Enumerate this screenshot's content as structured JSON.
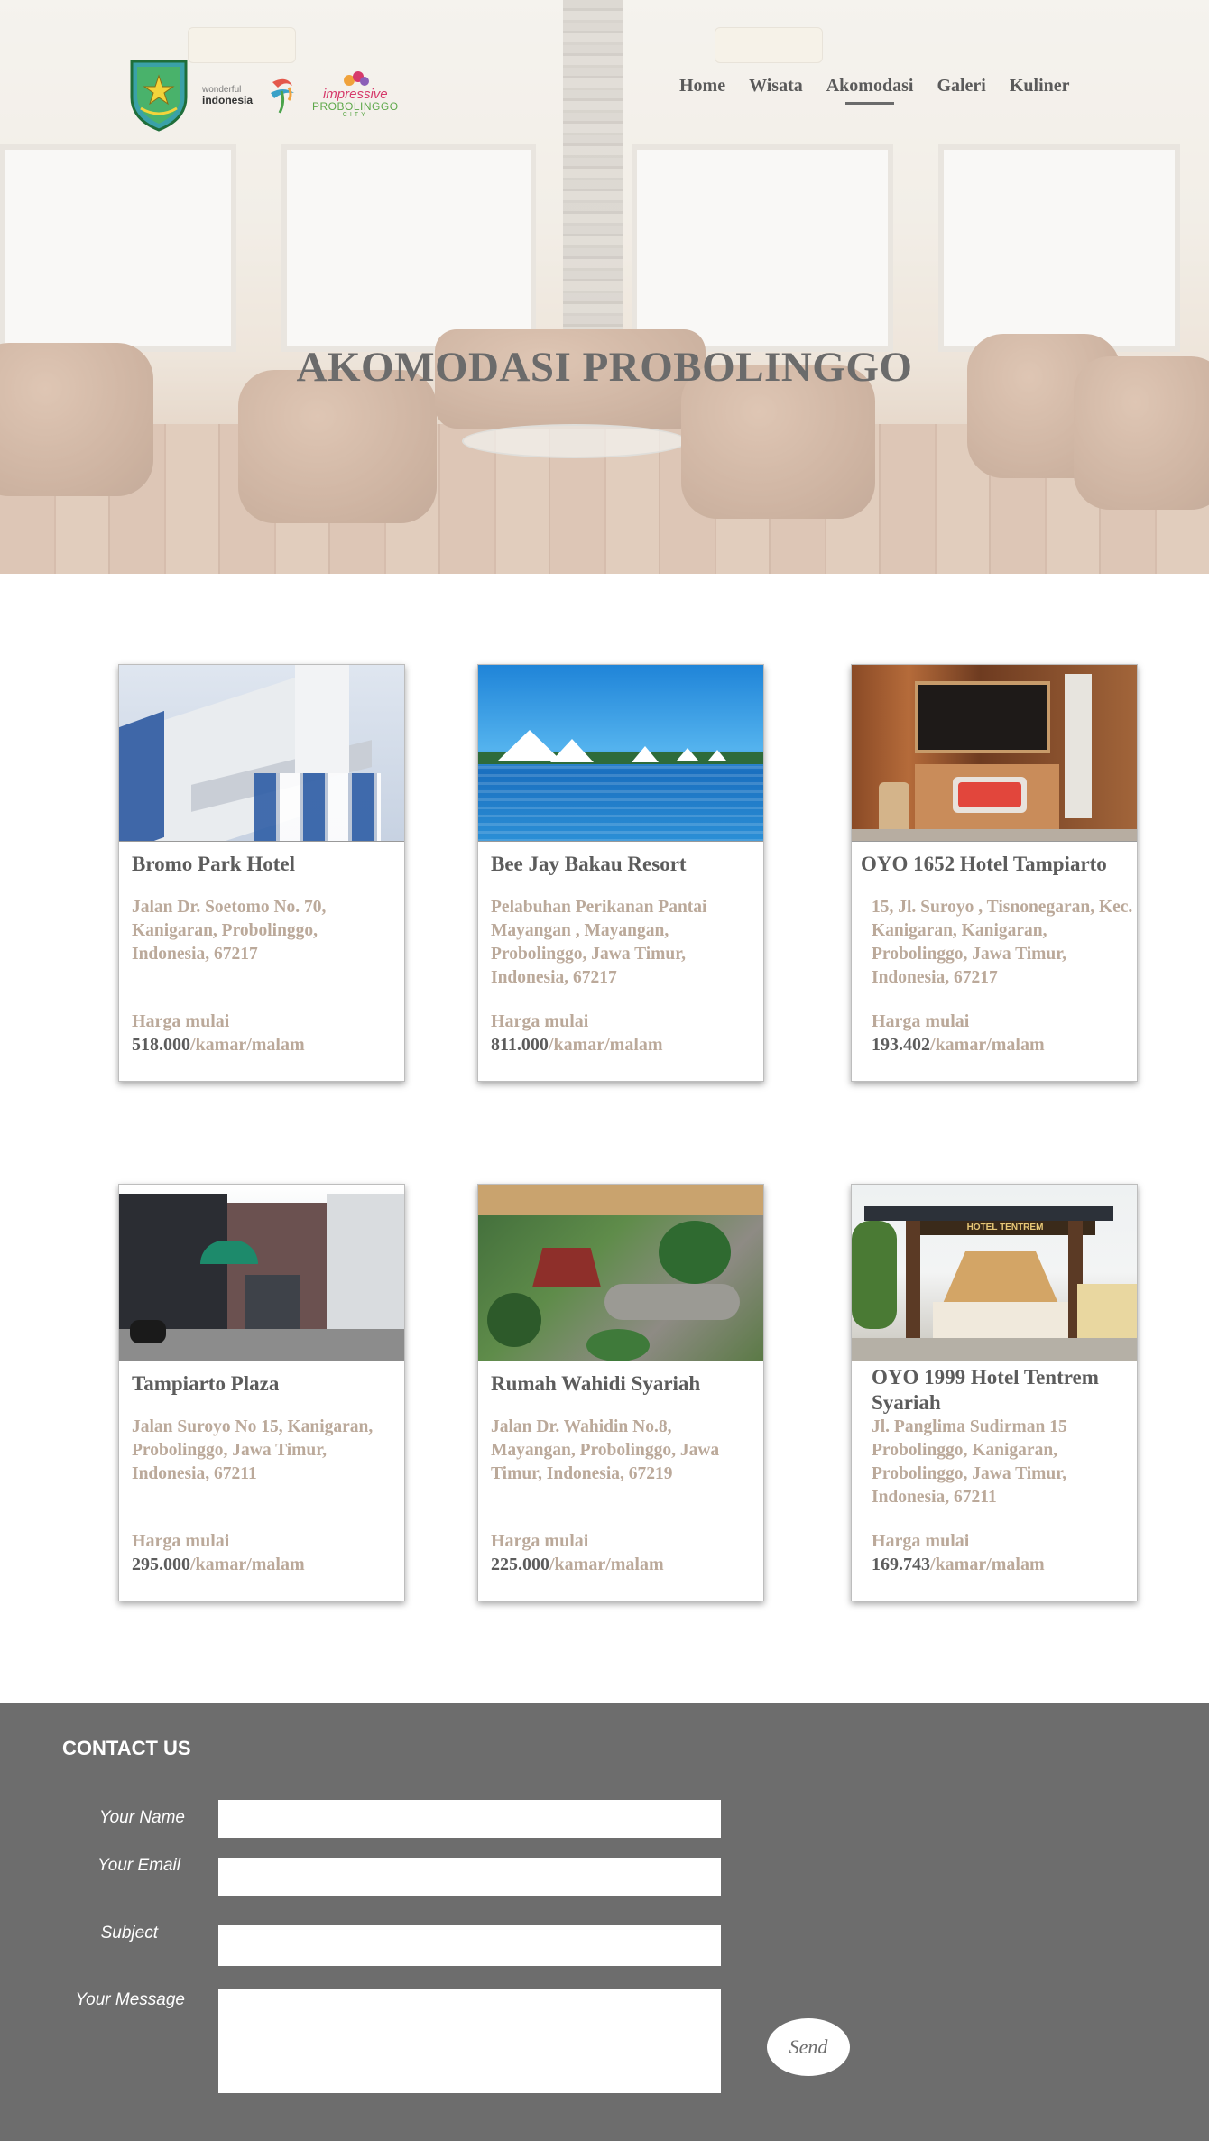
{
  "header": {
    "logos": {
      "wonderful_small": "wonderful",
      "wonderful_big": "indonesia",
      "impressive": "impressive",
      "impressive_city_name": "PROBOLINGGO",
      "impressive_city": "CITY"
    },
    "nav": [
      {
        "label": "Home",
        "active": false
      },
      {
        "label": "Wisata",
        "active": false
      },
      {
        "label": "Akomodasi",
        "active": true
      },
      {
        "label": "Galeri",
        "active": false
      },
      {
        "label": "Kuliner",
        "active": false
      }
    ]
  },
  "hero": {
    "title": "AKOMODASI PROBOLINGGO"
  },
  "hotels": [
    {
      "name": "Bromo Park Hotel",
      "address": "Jalan Dr. Soetomo No. 70, Kanigaran, Probolinggo, Indonesia, 67217",
      "price_label": "Harga mulai",
      "price": "518.000",
      "unit": "/kamar/malam",
      "photo": "hotel-building-photo"
    },
    {
      "name": "Bee Jay Bakau Resort",
      "address": "Pelabuhan Perikanan Pantai Mayangan , Mayangan, Probolinggo, Jawa Timur, Indonesia, 67217",
      "price_label": "Harga mulai",
      "price": "811.000",
      "unit": "/kamar/malam",
      "photo": "sea-resort-photo"
    },
    {
      "name": "OYO 1652 Hotel Tampiarto",
      "address": "15, Jl. Suroyo , Tisnonegaran, Kec. Kanigaran, Kanigaran, Probolinggo, Jawa Timur, Indonesia, 67217",
      "price_label": "Harga mulai",
      "price": "193.402",
      "unit": "/kamar/malam",
      "photo": "oyo-lobby-photo"
    },
    {
      "name": "Tampiarto Plaza",
      "address": "Jalan Suroyo No 15, Kanigaran, Probolinggo, Jawa Timur, Indonesia, 67211",
      "price_label": "Harga mulai",
      "price": "295.000",
      "unit": "/kamar/malam",
      "photo": "plaza-building-photo"
    },
    {
      "name": "Rumah Wahidi Syariah",
      "address": "Jalan Dr. Wahidin No.8, Mayangan, Probolinggo, Jawa Timur, Indonesia, 67219",
      "price_label": "Harga mulai",
      "price": "225.000",
      "unit": "/kamar/malam",
      "photo": "garden-aerial-photo"
    },
    {
      "name": "OYO 1999 Hotel Tentrem Syariah",
      "address": "Jl. Panglima Sudirman 15 Probolinggo, Kanigaran, Probolinggo, Jawa Timur, Indonesia, 67211",
      "price_label": "Harga mulai",
      "price": "169.743",
      "unit": "/kamar/malam",
      "photo": "hotel-gate-photo",
      "gate_sign": "HOTEL TENTREM"
    }
  ],
  "contact": {
    "title": "CONTACT US",
    "name_label": "Your Name",
    "email_label": "Your Email",
    "subject_label": "Subject",
    "message_label": "Your Message",
    "name_value": "",
    "email_value": "",
    "subject_value": "",
    "message_value": "",
    "send_label": "Send"
  },
  "colors": {
    "footer_bg": "#6d6d6d",
    "title_gray": "#6b6b6b",
    "address_tan": "#bba99a",
    "text_dark": "#5c5c5c"
  }
}
